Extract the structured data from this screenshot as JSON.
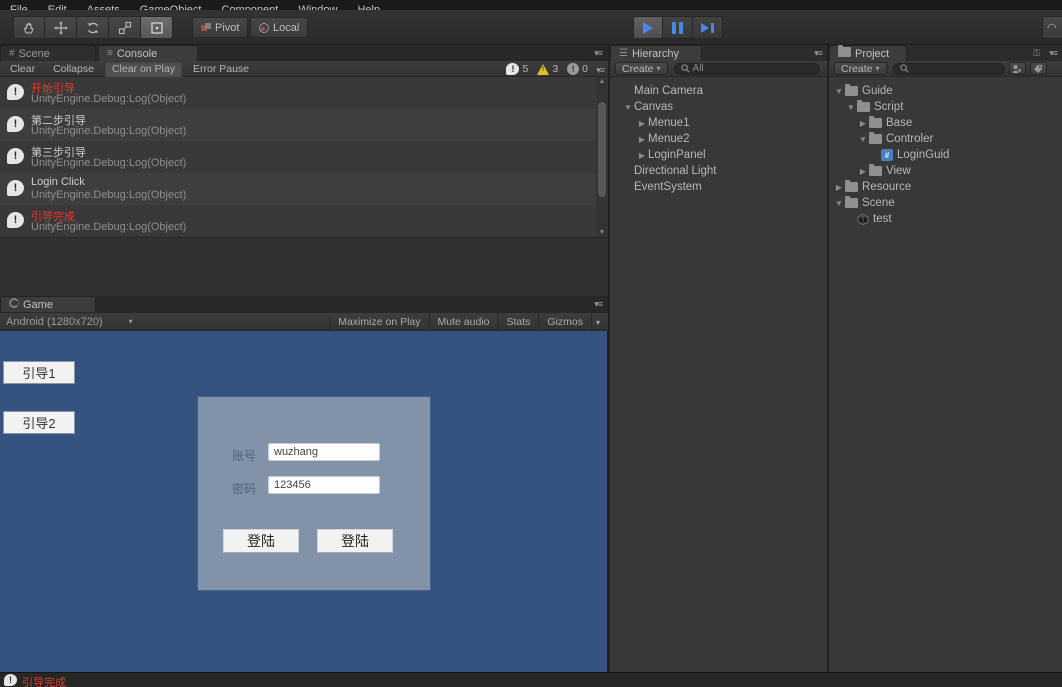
{
  "menu_bar": {
    "items": [
      "File",
      "Edit",
      "Assets",
      "GameObject",
      "Component",
      "Window",
      "Help"
    ]
  },
  "toolbar": {
    "tools": [
      {
        "name": "hand",
        "active": false
      },
      {
        "name": "move",
        "active": false
      },
      {
        "name": "rotate",
        "active": false
      },
      {
        "name": "scale",
        "active": false
      },
      {
        "name": "rect",
        "active": true
      }
    ],
    "pivot_label": "Pivot",
    "local_label": "Local",
    "play_accent_color": "#4a86e8"
  },
  "left_tabs": {
    "scene": "Scene",
    "console": "Console"
  },
  "console": {
    "buttons": [
      "Clear",
      "Collapse",
      "Clear on Play",
      "Error Pause"
    ],
    "active_button": "Clear on Play",
    "counts": {
      "info": "5",
      "warning": "3",
      "error": "0"
    },
    "error_text_color": "#e23a2e",
    "entries": [
      {
        "message": "开始引导",
        "source": "UnityEngine.Debug:Log(Object)",
        "red": true
      },
      {
        "message": "第二步引导",
        "source": "UnityEngine.Debug:Log(Object)",
        "red": false
      },
      {
        "message": "第三步引导",
        "source": "UnityEngine.Debug:Log(Object)",
        "red": false
      },
      {
        "message": "Login Click",
        "source": "UnityEngine.Debug:Log(Object)",
        "red": false
      },
      {
        "message": "引导完成",
        "source": "UnityEngine.Debug:Log(Object)",
        "red": true
      }
    ]
  },
  "game": {
    "tab_label": "Game",
    "aspect_label": "Android (1280x720)",
    "toolbar_buttons": [
      "Maximize on Play",
      "Mute audio",
      "Stats",
      "Gizmos"
    ],
    "background_color": "#345381",
    "guide_button_1": "引导1",
    "guide_button_2": "引导2",
    "login": {
      "account_label": "账号",
      "account_value": "wuzhang",
      "password_label": "密码",
      "password_value": "123456",
      "login_button_left": "登陆",
      "login_button_right": "登陆"
    }
  },
  "hierarchy": {
    "tab_label": "Hierarchy",
    "create_label": "Create",
    "search_label": "All",
    "items": [
      {
        "label": "Main Camera",
        "depth": 0,
        "arrow": "none"
      },
      {
        "label": "Canvas",
        "depth": 0,
        "arrow": "expanded"
      },
      {
        "label": "Menue1",
        "depth": 1,
        "arrow": "collapsed"
      },
      {
        "label": "Menue2",
        "depth": 1,
        "arrow": "collapsed"
      },
      {
        "label": "LoginPanel",
        "depth": 1,
        "arrow": "collapsed"
      },
      {
        "label": "Directional Light",
        "depth": 0,
        "arrow": "none"
      },
      {
        "label": "EventSystem",
        "depth": 0,
        "arrow": "none"
      }
    ]
  },
  "project": {
    "tab_label": "Project",
    "create_label": "Create",
    "items": [
      {
        "label": "Guide",
        "depth": 0,
        "arrow": "expanded",
        "icon": "folder"
      },
      {
        "label": "Script",
        "depth": 1,
        "arrow": "expanded",
        "icon": "folder"
      },
      {
        "label": "Base",
        "depth": 2,
        "arrow": "collapsed",
        "icon": "folder"
      },
      {
        "label": "Controler",
        "depth": 2,
        "arrow": "expanded",
        "icon": "folder"
      },
      {
        "label": "LoginGuid",
        "depth": 3,
        "arrow": "none",
        "icon": "csharp"
      },
      {
        "label": "View",
        "depth": 2,
        "arrow": "collapsed",
        "icon": "folder"
      },
      {
        "label": "Resource",
        "depth": 0,
        "arrow": "collapsed",
        "icon": "folder"
      },
      {
        "label": "Scene",
        "depth": 0,
        "arrow": "expanded",
        "icon": "folder"
      },
      {
        "label": "test",
        "depth": 1,
        "arrow": "none",
        "icon": "scene"
      }
    ]
  },
  "status_bar": {
    "message": "引导完成",
    "color": "#e23a2e"
  }
}
